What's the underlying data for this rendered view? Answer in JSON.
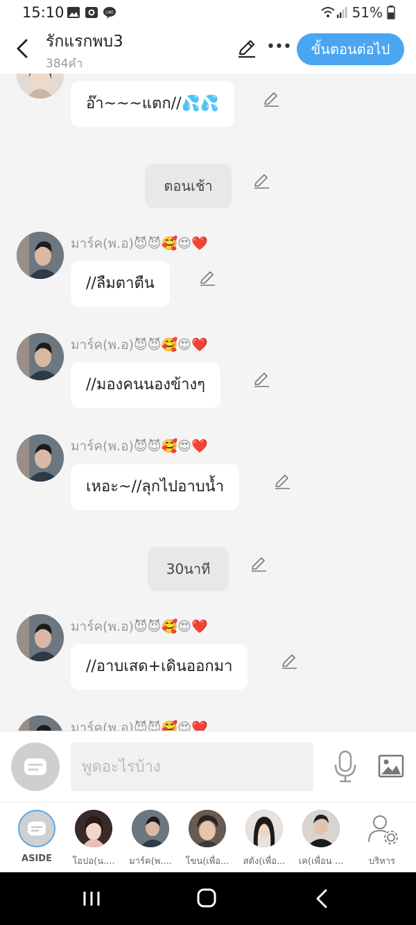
{
  "status": {
    "time": "15:10",
    "battery": "51%"
  },
  "header": {
    "title": "รักแรกพบ3",
    "word_count": "384คำ",
    "next_button": "ขั้นตอนต่อไป"
  },
  "messages": [
    {
      "kind": "bubble",
      "text": "อ๊า~~~แตก//💦💦"
    },
    {
      "kind": "scene",
      "text": "ตอนเช้า"
    },
    {
      "kind": "bubble",
      "sender": "มาร์ค(พ.อ)😈😈🥰😍❤️",
      "text": "//ลืมตาตืน"
    },
    {
      "kind": "bubble",
      "sender": "มาร์ค(พ.อ)😈😈🥰😍❤️",
      "text": "//มองคนนองข้างๆ"
    },
    {
      "kind": "bubble",
      "sender": "มาร์ค(พ.อ)😈😈🥰😍❤️",
      "text": "เหอะ~//ลุกไปอาบน้ำ"
    },
    {
      "kind": "scene",
      "text": "30นาที"
    },
    {
      "kind": "bubble",
      "sender": "มาร์ค(พ.อ)😈😈🥰😍❤️",
      "text": "//อาบเสด+เดินออกมา"
    },
    {
      "kind": "partial",
      "sender": "มาร์ค(พ.อ)😈😈🥰😍❤️"
    }
  ],
  "input": {
    "placeholder": "พูดอะไรบ้าง"
  },
  "characters": [
    {
      "label": "ASIDE"
    },
    {
      "label": "โอปอ(น...."
    },
    {
      "label": "มาร์ค(พ...."
    },
    {
      "label": "โขน(เพื่อ..."
    },
    {
      "label": "สตัง(เพื่อ..."
    },
    {
      "label": "เค(เพื่อน ..."
    },
    {
      "label": "บริหาร"
    }
  ],
  "colors": {
    "accent": "#4aa6f0",
    "background": "#f4f4f4",
    "bubble": "#ffffff",
    "scene_pill": "#e8e8e8"
  }
}
